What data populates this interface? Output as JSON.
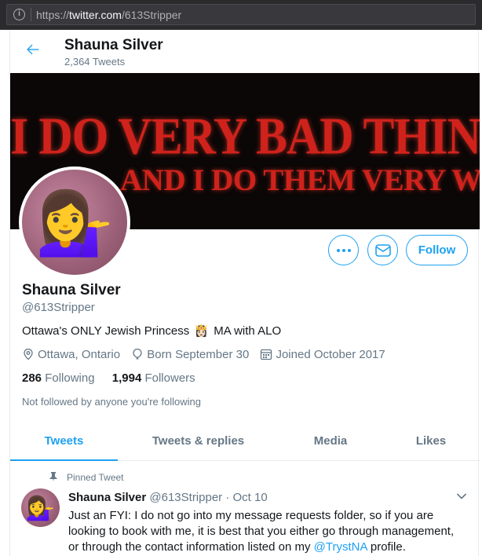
{
  "browser": {
    "url_prefix": "https://",
    "url_domain": "twitter.com",
    "url_path": "/613Stripper"
  },
  "header": {
    "name": "Shauna Silver",
    "tweet_count": "2,364 Tweets"
  },
  "banner": {
    "line1": "I DO VERY BAD THINGS",
    "line2": "AND I DO THEM VERY WELL"
  },
  "avatar": {
    "emoji_crown": "👑",
    "emoji_person": "💁‍♀️"
  },
  "actions": {
    "follow_label": "Follow"
  },
  "profile": {
    "name": "Shauna Silver",
    "handle": "@613Stripper",
    "bio_before": "Ottawa's ONLY Jewish Princess",
    "bio_emoji": "👸🏻",
    "bio_after": "MA with ALO",
    "location": "Ottawa, Ontario",
    "born": "Born September 30",
    "joined": "Joined October 2017",
    "following_count": "286",
    "following_label": "Following",
    "followers_count": "1,994",
    "followers_label": "Followers",
    "not_followed": "Not followed by anyone you're following"
  },
  "tabs": [
    {
      "label": "Tweets",
      "active": true
    },
    {
      "label": "Tweets & replies",
      "active": false
    },
    {
      "label": "Media",
      "active": false
    },
    {
      "label": "Likes",
      "active": false
    }
  ],
  "pinned_tweet": {
    "pinned_label": "Pinned Tweet",
    "author_name": "Shauna Silver",
    "author_handle": "@613Stripper",
    "separator": "·",
    "date": "Oct 10",
    "text_before": "Just an FYI: I do not go into my message requests folder, so if you are looking to book with me, it is best that you either go through management, or through the contact information listed on my ",
    "mention": "@TrystNA",
    "text_after": " profile."
  },
  "colors": {
    "accent": "#1da1f2",
    "secondary_text": "#657786",
    "banner_text": "#d0221c"
  }
}
